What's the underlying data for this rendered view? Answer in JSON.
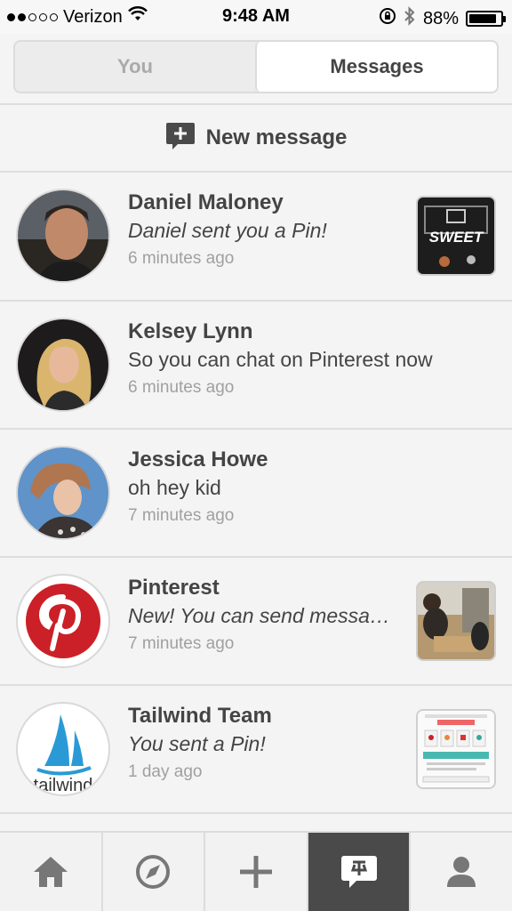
{
  "status_bar": {
    "carrier": "Verizon",
    "time": "9:48 AM",
    "battery": "88%",
    "signal_bars_filled": 2,
    "signal_bars_total": 5
  },
  "tabs": {
    "you_label": "You",
    "messages_label": "Messages",
    "selected": "Messages"
  },
  "new_message": {
    "label": "New message"
  },
  "messages": [
    {
      "name": "Daniel Maloney",
      "text": "Daniel sent you a Pin!",
      "time": "6 minutes ago",
      "thumb_text": "SWEET"
    },
    {
      "name": "Kelsey Lynn",
      "text": "So you can chat on Pinterest now",
      "time": "6 minutes ago"
    },
    {
      "name": "Jessica Howe",
      "text": "oh hey kid",
      "time": "7 minutes ago"
    },
    {
      "name": "Pinterest",
      "text": "New! You can send messages",
      "time": "7 minutes ago"
    },
    {
      "name": "Tailwind Team",
      "text": "You sent a Pin!",
      "time": "1 day ago",
      "avatar_text": "tailwind"
    }
  ],
  "bottom_nav": {
    "items": [
      "home-icon",
      "explore-icon",
      "add-icon",
      "messages-icon",
      "profile-icon"
    ],
    "active": "messages-icon"
  },
  "colors": {
    "pinterest_red": "#cb2027",
    "tailwind_blue": "#2a9ad6",
    "active_tab_bg": "#4a4a4a"
  }
}
